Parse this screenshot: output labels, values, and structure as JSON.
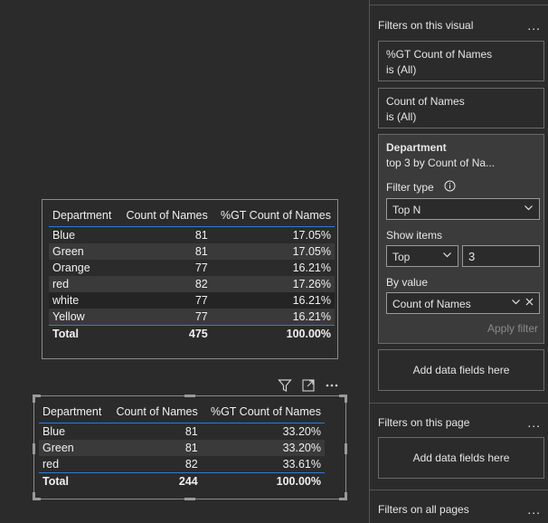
{
  "visual1": {
    "headers": [
      "Department",
      "Count of Names",
      "%GT Count of Names"
    ],
    "rows": [
      [
        "Blue",
        "81",
        "17.05%"
      ],
      [
        "Green",
        "81",
        "17.05%"
      ],
      [
        "Orange",
        "77",
        "16.21%"
      ],
      [
        "red",
        "82",
        "17.26%"
      ],
      [
        "white",
        "77",
        "16.21%"
      ],
      [
        "Yellow",
        "77",
        "16.21%"
      ]
    ],
    "total": [
      "Total",
      "475",
      "100.00%"
    ]
  },
  "visual2": {
    "headers": [
      "Department",
      "Count of Names",
      "%GT Count of Names"
    ],
    "rows": [
      [
        "Blue",
        "81",
        "33.20%"
      ],
      [
        "Green",
        "81",
        "33.20%"
      ],
      [
        "red",
        "82",
        "33.61%"
      ]
    ],
    "total": [
      "Total",
      "244",
      "100.00%"
    ]
  },
  "icons": {
    "filter": "filter-icon",
    "focus": "focus-mode-icon",
    "more": "more-options-icon"
  },
  "filter_pane": {
    "visual_section_title": "Filters on this visual",
    "ellipsis": "...",
    "cards": [
      {
        "title": "%GT Count of Names",
        "subtitle": "is (All)"
      },
      {
        "title": "Count of Names",
        "subtitle": "is (All)"
      }
    ],
    "department": {
      "title": "Department",
      "subtitle": "top 3 by Count of Na...",
      "filter_type_label": "Filter type",
      "filter_type_value": "Top N",
      "show_items_label": "Show items",
      "show_items_direction": "Top",
      "show_items_count": "3",
      "by_value_label": "By value",
      "by_value_field": "Count of Names",
      "apply_label": "Apply filter"
    },
    "add_fields_label": "Add data fields here",
    "page_section_title": "Filters on this page",
    "all_pages_section_title": "Filters on all pages"
  },
  "colors": {
    "background": "#2b2b2b",
    "accent_line": "#2f7bd6",
    "expanded_card": "#3b3b3b"
  }
}
